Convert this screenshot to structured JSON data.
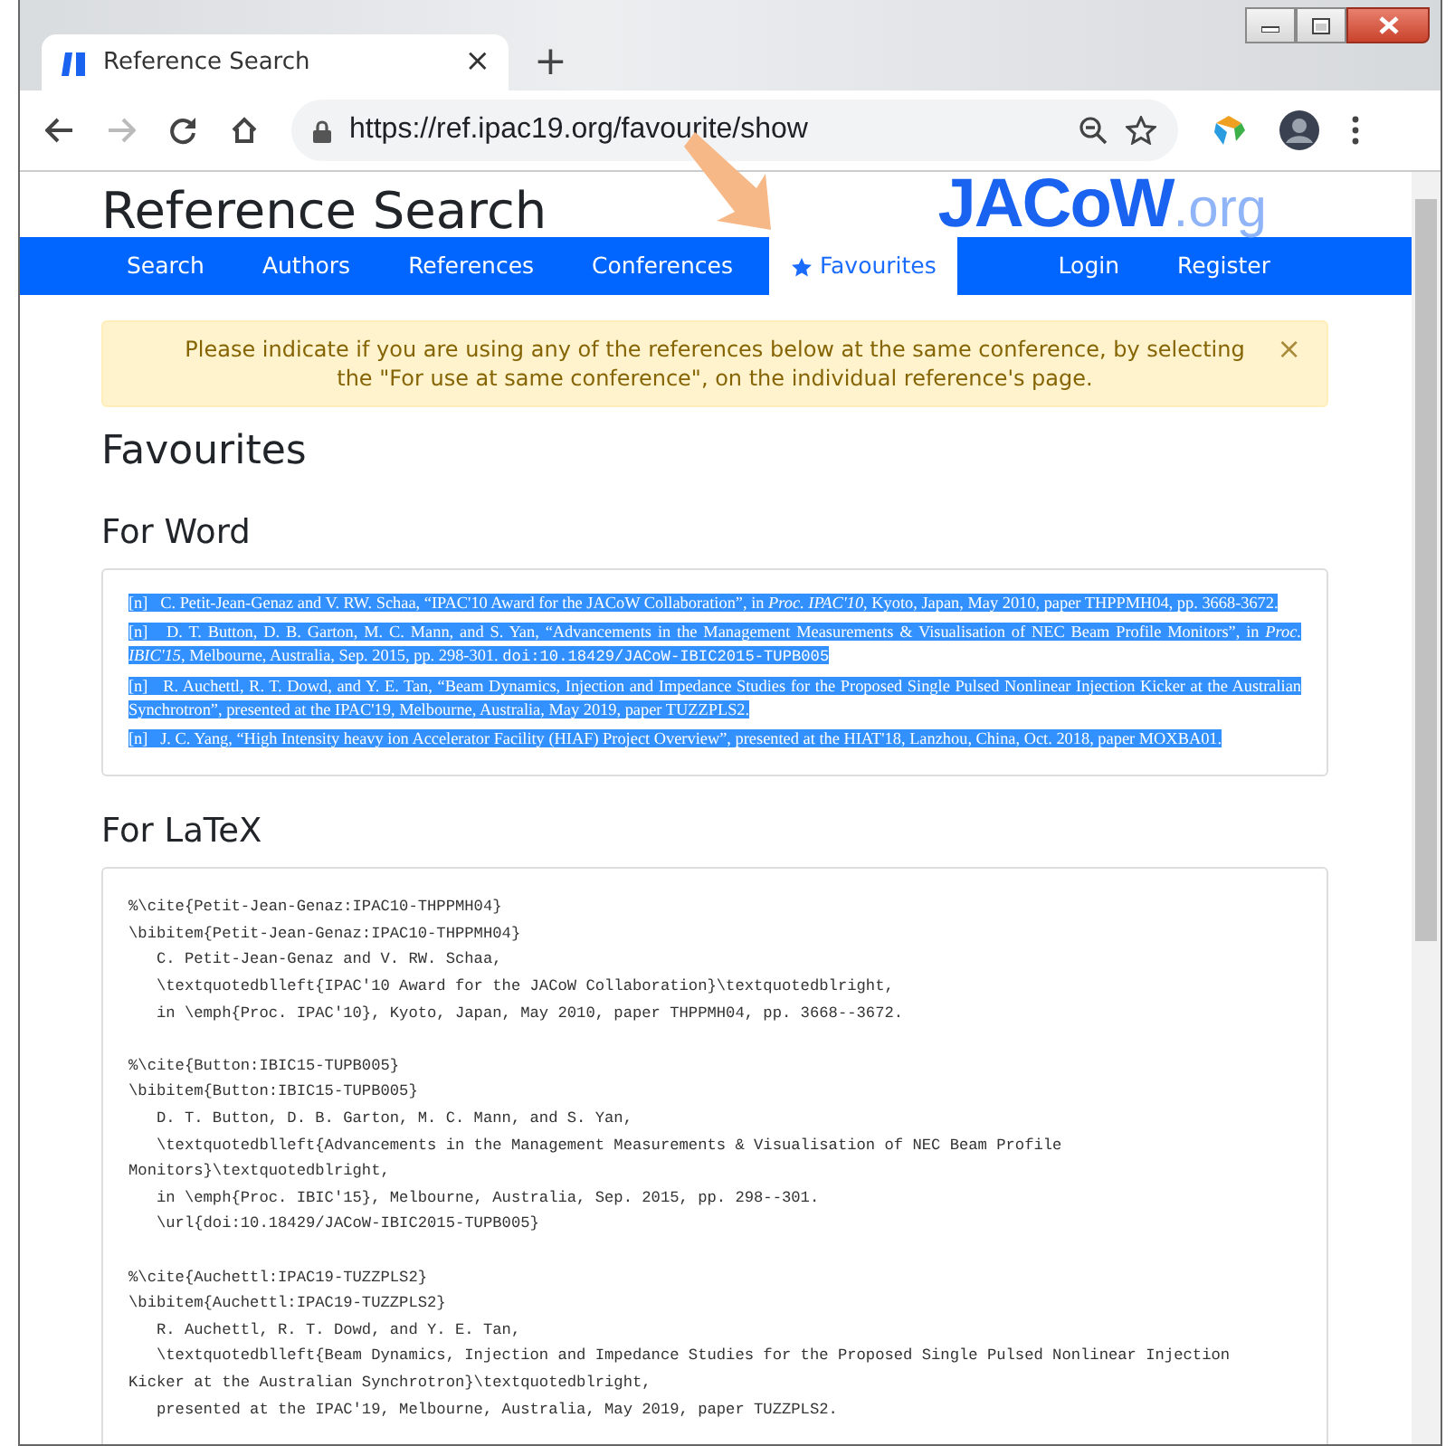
{
  "browser": {
    "tab_title": "Reference Search",
    "tab_close": "×",
    "new_tab": "+",
    "url": "https://ref.ipac19.org/favourite/show"
  },
  "site": {
    "title": "Reference Search",
    "logo_main": "JACoW",
    "logo_suffix": ".org"
  },
  "nav": {
    "left": [
      {
        "label": "Search",
        "selected": false
      },
      {
        "label": "Authors",
        "selected": false
      },
      {
        "label": "References",
        "selected": false
      },
      {
        "label": "Conferences",
        "selected": false
      },
      {
        "label": "Favourites",
        "selected": true,
        "kind": "starred"
      }
    ],
    "right": [
      {
        "label": "Login",
        "selected": false
      },
      {
        "label": "Register",
        "selected": false
      }
    ]
  },
  "alert": {
    "text": "Please indicate if you are using any of the references below at the same conference, by selecting the \"For use at same conference\", on the individual reference's page.",
    "close": "×"
  },
  "heading": "Favourites",
  "for_word": {
    "heading": "For Word",
    "text_selected": true,
    "references": [
      {
        "marker": "[n]",
        "text": "C. Petit-Jean-Genaz and V. RW. Schaa, “IPAC'10 Award for the JACoW Collaboration”, in *Proc. IPAC'10*, Kyoto, Japan, May 2010, paper THPPMH04, pp. 3668-3672."
      },
      {
        "marker": "[n]",
        "text": "D. T. Button, D. B. Garton, M. C. Mann, and S. Yan, “Advancements in the Management Measurements & Visualisation of NEC Beam Profile Monitors”, in *Proc. IBIC'15*, Melbourne, Australia, Sep. 2015, pp. 298-301.",
        "doi": "doi:10.18429/JACoW-IBIC2015-TUPB005"
      },
      {
        "marker": "[n]",
        "text": "R. Auchettl, R. T. Dowd, and Y. E. Tan, “Beam Dynamics, Injection and Impedance Studies for the Proposed Single Pulsed Nonlinear Injection Kicker at the Australian Synchrotron”, presented at the IPAC'19, Melbourne, Australia, May 2019, paper TUZZPLS2."
      },
      {
        "marker": "[n]",
        "text": "J. C. Yang, “High Intensity heavy ion Accelerator Facility (HIAF) Project Overview”, presented at the HIAT'18, Lanzhou, China, Oct. 2018, paper MOXBA01."
      }
    ]
  },
  "for_latex": {
    "heading": "For LaTeX",
    "entries": [
      {
        "lines": [
          "%\\cite{Petit-Jean-Genaz:IPAC10-THPPMH04}",
          "\\bibitem{Petit-Jean-Genaz:IPAC10-THPPMH04}",
          "   C. Petit-Jean-Genaz and V. RW. Schaa,",
          "   \\textquotedblleft{IPAC'10 Award for the JACoW Collaboration}\\textquotedblright,",
          "   in \\emph{Proc. IPAC'10}, Kyoto, Japan, May 2010, paper THPPMH04, pp. 3668--3672."
        ]
      },
      {
        "lines": [
          "%\\cite{Button:IBIC15-TUPB005}",
          "\\bibitem{Button:IBIC15-TUPB005}",
          "   D. T. Button, D. B. Garton, M. C. Mann, and S. Yan,",
          "   \\textquotedblleft{Advancements in the Management Measurements & Visualisation of NEC Beam Profile",
          "Monitors}\\textquotedblright,",
          "   in \\emph{Proc. IBIC'15}, Melbourne, Australia, Sep. 2015, pp. 298--301.",
          "   \\url{doi:10.18429/JACoW-IBIC2015-TUPB005}"
        ]
      },
      {
        "lines": [
          "%\\cite{Auchettl:IPAC19-TUZZPLS2}",
          "\\bibitem{Auchettl:IPAC19-TUZZPLS2}",
          "   R. Auchettl, R. T. Dowd, and Y. E. Tan,",
          "   \\textquotedblleft{Beam Dynamics, Injection and Impedance Studies for the Proposed Single Pulsed Nonlinear Injection",
          "Kicker at the Australian Synchrotron}\\textquotedblright,",
          "   presented at the IPAC'19, Melbourne, Australia, May 2019, paper TUZZPLS2."
        ]
      }
    ]
  }
}
